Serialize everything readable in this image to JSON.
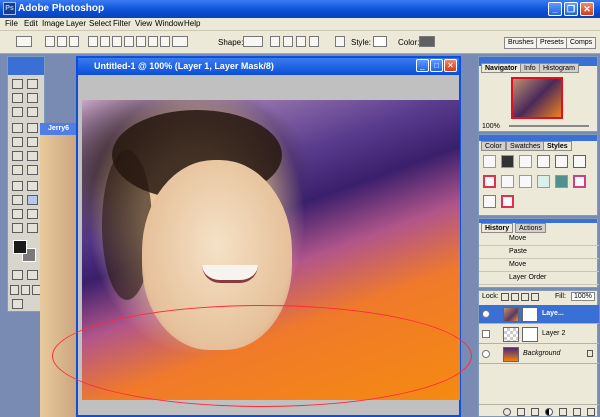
{
  "app": {
    "title": "Adobe Photoshop"
  },
  "menu": [
    "File",
    "Edit",
    "Image",
    "Layer",
    "Select",
    "Filter",
    "View",
    "Window",
    "Help"
  ],
  "options": {
    "shape_label": "Shape:",
    "style_label": "Style:",
    "color_label": "Color:",
    "color_value": "#606060",
    "well_tabs": [
      "Brushes",
      "Presets",
      "Comps"
    ]
  },
  "document": {
    "title": "Untitled-1 @ 100% (Layer 1, Layer Mask/8)",
    "background_doc_title": "Jerry6"
  },
  "navigator": {
    "tabs": [
      "Navigator",
      "Info",
      "Histogram"
    ],
    "zoom": "100%"
  },
  "color_panel": {
    "tabs": [
      "Color",
      "Swatches",
      "Styles"
    ]
  },
  "history": {
    "tabs": [
      "History",
      "Actions"
    ],
    "items": [
      "Move",
      "Paste",
      "Move",
      "Layer Order"
    ]
  },
  "layers": {
    "lock_label": "Lock:",
    "fill_label": "Fill:",
    "fill_value": "100%",
    "items": [
      {
        "name": "Laye...",
        "selected": true
      },
      {
        "name": "Layer 2",
        "selected": false
      },
      {
        "name": "Background",
        "selected": false
      }
    ]
  },
  "colors": {
    "titlebar": "#0a4fd6",
    "annotation": "#ff2a3c",
    "foreground_swatch": "#1a1a1a",
    "background_swatch": "#7a7a7a"
  }
}
